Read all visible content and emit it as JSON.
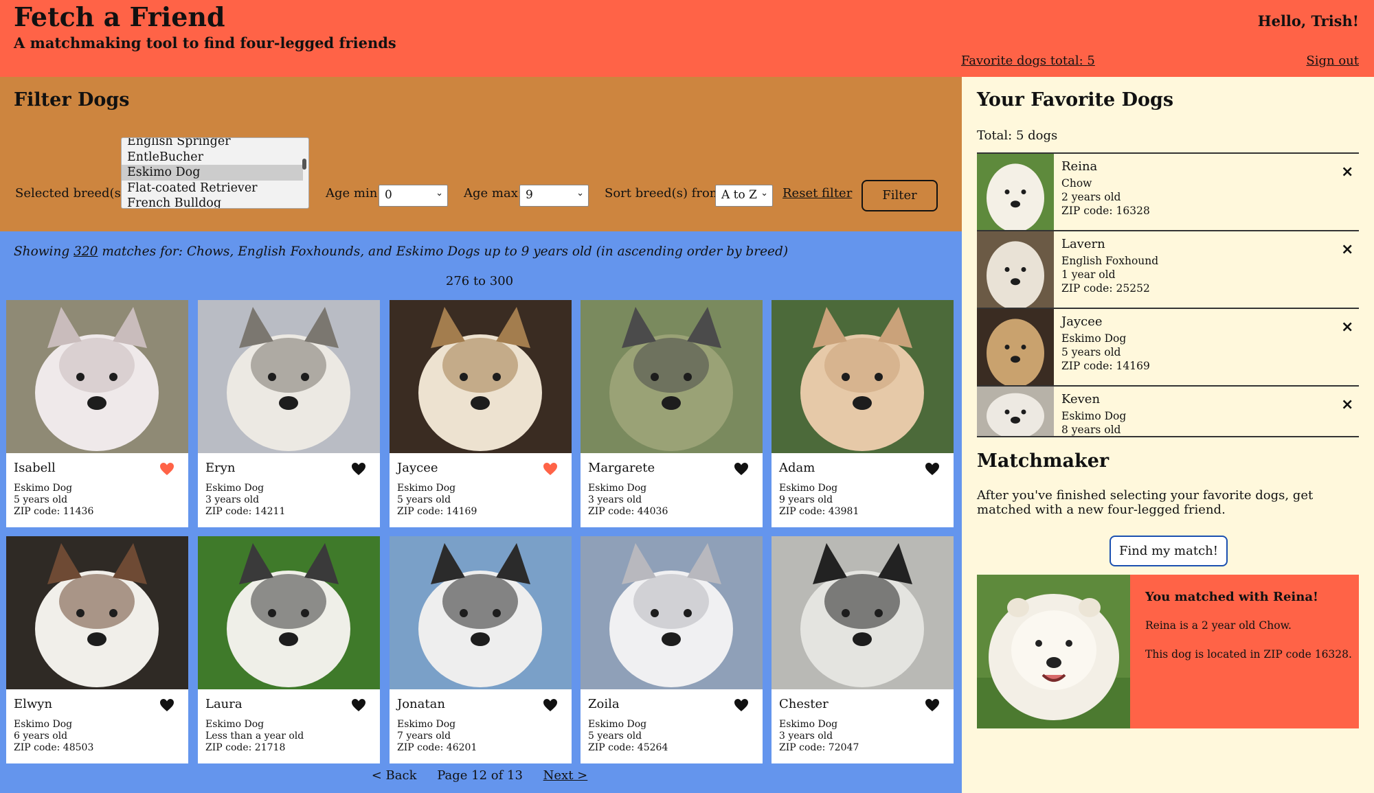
{
  "header": {
    "title": "Fetch a Friend",
    "subtitle": "A matchmaking tool to find four-legged friends",
    "greeting": "Hello, Trish!",
    "favorites_link": "Favorite dogs total: 5",
    "signout": "Sign out",
    "color": "#FF6347"
  },
  "filter": {
    "title": "Filter Dogs",
    "breed_label": "Selected breed(s):",
    "breed_options": [
      "English Springer",
      "EntleBucher",
      "Eskimo Dog",
      "Flat-coated Retriever",
      "French Bulldog"
    ],
    "selected_breed": "Eskimo Dog",
    "age_min_label": "Age min:",
    "age_min_value": "0",
    "age_max_label": "Age max:",
    "age_max_value": "9",
    "sort_label": "Sort breed(s) from",
    "sort_value": "A to Z",
    "reset": "Reset filter",
    "submit": "Filter",
    "color": "#CD853F"
  },
  "results": {
    "summary_prefix": "Showing",
    "count": "320",
    "summary_suffix": "matches for: Chows, English Foxhounds, and Eskimo Dogs up to 9 years old (in ascending order by breed)",
    "range": "276 to 300",
    "color": "#6495ED",
    "dogs": [
      {
        "name": "Isabell",
        "breed": "Eskimo Dog",
        "age": "5 years old",
        "zip": "ZIP code: 11436",
        "favorite": true
      },
      {
        "name": "Eryn",
        "breed": "Eskimo Dog",
        "age": "3 years old",
        "zip": "ZIP code: 14211",
        "favorite": false
      },
      {
        "name": "Jaycee",
        "breed": "Eskimo Dog",
        "age": "5 years old",
        "zip": "ZIP code: 14169",
        "favorite": true
      },
      {
        "name": "Margarete",
        "breed": "Eskimo Dog",
        "age": "3 years old",
        "zip": "ZIP code: 44036",
        "favorite": false
      },
      {
        "name": "Adam",
        "breed": "Eskimo Dog",
        "age": "9 years old",
        "zip": "ZIP code: 43981",
        "favorite": false
      },
      {
        "name": "Elwyn",
        "breed": "Eskimo Dog",
        "age": "6 years old",
        "zip": "ZIP code: 48503",
        "favorite": false
      },
      {
        "name": "Laura",
        "breed": "Eskimo Dog",
        "age": "Less than a year old",
        "zip": "ZIP code: 21718",
        "favorite": false
      },
      {
        "name": "Jonatan",
        "breed": "Eskimo Dog",
        "age": "7 years old",
        "zip": "ZIP code: 46201",
        "favorite": false
      },
      {
        "name": "Zoila",
        "breed": "Eskimo Dog",
        "age": "5 years old",
        "zip": "ZIP code: 45264",
        "favorite": false
      },
      {
        "name": "Chester",
        "breed": "Eskimo Dog",
        "age": "3 years old",
        "zip": "ZIP code: 72047",
        "favorite": false
      }
    ],
    "pager": {
      "back": "< Back",
      "page": "Page 12 of 13",
      "next": "Next >"
    }
  },
  "sidebar": {
    "title": "Your Favorite Dogs",
    "total": "Total: 5 dogs",
    "favorites": [
      {
        "name": "Reina",
        "breed": "Chow",
        "age": "2 years old",
        "zip": "ZIP code: 16328"
      },
      {
        "name": "Lavern",
        "breed": "English Foxhound",
        "age": "1 year old",
        "zip": "ZIP code: 25252"
      },
      {
        "name": "Jaycee",
        "breed": "Eskimo Dog",
        "age": "5 years old",
        "zip": "ZIP code: 14169"
      },
      {
        "name": "Keven",
        "breed": "Eskimo Dog",
        "age": "8 years old",
        "zip": ""
      }
    ],
    "remove_icon": "×",
    "matchmaker_title": "Matchmaker",
    "matchmaker_desc": "After you've finished selecting your favorite dogs, get matched with a new four-legged friend.",
    "match_button": "Find my match!",
    "match_result": {
      "headline": "You matched with Reina!",
      "line1": "Reina is a 2 year old Chow.",
      "line2": "This dog is located in ZIP code 16328."
    },
    "color": "#FFF8DC"
  },
  "icons": {
    "favorite": "heart-icon",
    "remove": "close-icon",
    "dropdown": "chevron-down-icon"
  }
}
